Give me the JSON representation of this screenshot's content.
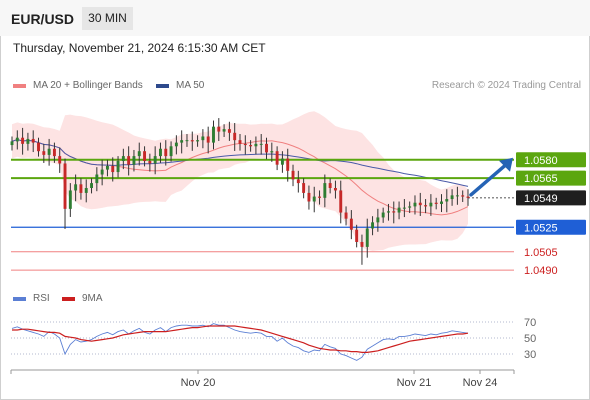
{
  "header": {
    "symbol": "EUR/USD",
    "timeframe": "30 MIN"
  },
  "datetime": "Thursday, November 21, 2024 6:15:30 AM CET",
  "legend": {
    "ma_bb": "MA 20 + Bollinger Bands",
    "ma50": "MA 50"
  },
  "credit": "Research © 2024 Trading Central",
  "rsi_legend": {
    "rsi": "RSI",
    "ma9": "9MA"
  },
  "colors": {
    "up": "#2e7d32",
    "down": "#c62828",
    "resistance": "#5ba60f",
    "support": "#1f5fd6",
    "pivot": "#f08080",
    "ma20": "#f08080",
    "ma50": "#4a5aa8",
    "band": "#fde3e3",
    "arrow": "#2563b5",
    "rsi": "#5b7fd4",
    "rsi_ma": "#cc1f1f"
  },
  "chart_data": {
    "type": "candlestick",
    "ylim": [
      1.0482,
      1.0632
    ],
    "current_price": "1.0549",
    "levels": [
      {
        "label": "1.0580",
        "value": 1.058,
        "kind": "resistance"
      },
      {
        "label": "1.0565",
        "value": 1.0565,
        "kind": "resistance"
      },
      {
        "label": "1.0525",
        "value": 1.0525,
        "kind": "support"
      },
      {
        "label": "1.0505",
        "value": 1.0505,
        "kind": "pivot"
      },
      {
        "label": "1.0490",
        "value": 1.049,
        "kind": "pivot"
      }
    ],
    "forecast_target": 1.058,
    "x_labels": [
      "Nov 20",
      "Nov 21",
      "Nov 24"
    ],
    "close": [
      1.0595,
      1.0598,
      1.0593,
      1.0597,
      1.0594,
      1.0587,
      1.0584,
      1.0589,
      1.0583,
      1.0577,
      1.054,
      1.0555,
      1.056,
      1.0553,
      1.0557,
      1.0561,
      1.0568,
      1.0572,
      1.0575,
      1.057,
      1.0579,
      1.0583,
      1.0576,
      1.0583,
      1.0587,
      1.0579,
      1.0577,
      1.0583,
      1.0589,
      1.0583,
      1.0591,
      1.0594,
      1.0596,
      1.0596,
      1.0595,
      1.0596,
      1.0599,
      1.0594,
      1.0607,
      1.0603,
      1.0605,
      1.0602,
      1.0596,
      1.0593,
      1.0592,
      1.0591,
      1.0593,
      1.0593,
      1.0586,
      1.0587,
      1.0576,
      1.0581,
      1.0571,
      1.0564,
      1.0561,
      1.0553,
      1.0546,
      1.055,
      1.0549,
      1.0561,
      1.0557,
      1.0555,
      1.0537,
      1.0532,
      1.0523,
      1.0513,
      1.0509,
      1.0524,
      1.0529,
      1.0533,
      1.0537,
      1.0538,
      1.0537,
      1.0541,
      1.0541,
      1.0542,
      1.0545,
      1.0543,
      1.0542,
      1.0545,
      1.0544,
      1.0546,
      1.0548,
      1.0551,
      1.0551,
      1.055,
      1.0549
    ],
    "rsi_ylim": [
      10,
      85
    ],
    "rsi_ticks": [
      70,
      50,
      30
    ],
    "rsi": [
      62,
      64,
      61,
      59,
      57,
      55,
      52,
      58,
      55,
      50,
      30,
      42,
      48,
      45,
      46,
      48,
      52,
      55,
      57,
      54,
      58,
      60,
      55,
      59,
      62,
      57,
      55,
      60,
      63,
      58,
      63,
      65,
      66,
      66,
      65,
      65,
      66,
      64,
      68,
      66,
      66,
      63,
      60,
      58,
      57,
      56,
      57,
      56,
      52,
      52,
      46,
      50,
      44,
      40,
      38,
      34,
      32,
      35,
      34,
      42,
      39,
      37,
      30,
      28,
      25,
      22,
      26,
      36,
      40,
      44,
      48,
      49,
      48,
      52,
      52,
      53,
      55,
      54,
      53,
      55,
      54,
      56,
      57,
      59,
      58,
      57,
      56
    ],
    "rsi_ma": [
      60,
      60,
      61,
      61,
      60,
      59,
      58,
      57,
      57,
      56,
      52,
      51,
      50,
      48,
      47,
      46,
      47,
      48,
      49,
      50,
      52,
      54,
      55,
      56,
      57,
      58,
      58,
      58,
      58,
      58,
      59,
      60,
      61,
      62,
      63,
      63,
      64,
      65,
      65,
      65,
      65,
      65,
      65,
      64,
      63,
      62,
      61,
      60,
      58,
      56,
      54,
      52,
      50,
      48,
      46,
      44,
      41,
      39,
      37,
      36,
      35,
      35,
      34,
      34,
      33,
      33,
      32,
      32,
      33,
      34,
      36,
      38,
      40,
      42,
      44,
      46,
      47,
      48,
      49,
      50,
      51,
      52,
      53,
      54,
      55,
      55,
      56
    ]
  }
}
